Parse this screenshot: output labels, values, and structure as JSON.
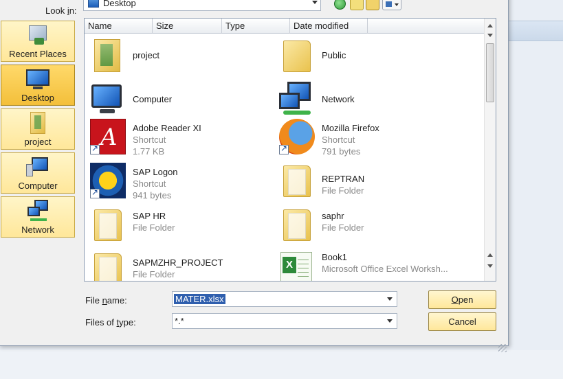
{
  "dialog": {
    "look_in": {
      "label_pre": "Look ",
      "label_key": "i",
      "label_post": "n:",
      "value": "Desktop"
    },
    "places": [
      {
        "id": "recent",
        "label": "Recent Places"
      },
      {
        "id": "desktop",
        "label": "Desktop",
        "selected": true
      },
      {
        "id": "project",
        "label": "project"
      },
      {
        "id": "computer",
        "label": "Computer"
      },
      {
        "id": "network",
        "label": "Network"
      }
    ],
    "columns": [
      "Name",
      "Size",
      "Type",
      "Date modified"
    ],
    "items": [
      {
        "name": "project",
        "line2": "",
        "line3": "",
        "icon": "project-folder-icon"
      },
      {
        "name": "Public",
        "line2": "",
        "line3": "",
        "icon": "folder-icon"
      },
      {
        "name": "Computer",
        "line2": "",
        "line3": "",
        "icon": "computer-icon"
      },
      {
        "name": "Network",
        "line2": "",
        "line3": "",
        "icon": "network-icon"
      },
      {
        "name": "Adobe Reader XI",
        "line2": "Shortcut",
        "line3": "1.77 KB",
        "icon": "adobe-reader-icon"
      },
      {
        "name": "Mozilla Firefox",
        "line2": "Shortcut",
        "line3": "791 bytes",
        "icon": "firefox-icon"
      },
      {
        "name": "SAP Logon",
        "line2": "Shortcut",
        "line3": "941 bytes",
        "icon": "sap-logon-icon"
      },
      {
        "name": "REPTRAN",
        "line2": "File Folder",
        "line3": "",
        "icon": "folder-icon"
      },
      {
        "name": "SAP HR",
        "line2": "File Folder",
        "line3": "",
        "icon": "folder-icon"
      },
      {
        "name": "saphr",
        "line2": "File Folder",
        "line3": "",
        "icon": "folder-icon"
      },
      {
        "name": "SAPMZHR_PROJECT",
        "line2": "File Folder",
        "line3": "",
        "icon": "folder-icon"
      },
      {
        "name": "Book1",
        "line2": "Microsoft Office Excel Worksh...",
        "line3": "",
        "icon": "excel-icon"
      }
    ],
    "file_name": {
      "label_pre": "File ",
      "label_key": "n",
      "label_post": "ame:",
      "value": "MATER.xlsx"
    },
    "file_type": {
      "label_pre": "Files of ",
      "label_key": "t",
      "label_post": "ype:",
      "value": "*.*"
    },
    "buttons": {
      "open_key": "O",
      "open_rest": "pen",
      "cancel": "Cancel"
    }
  }
}
